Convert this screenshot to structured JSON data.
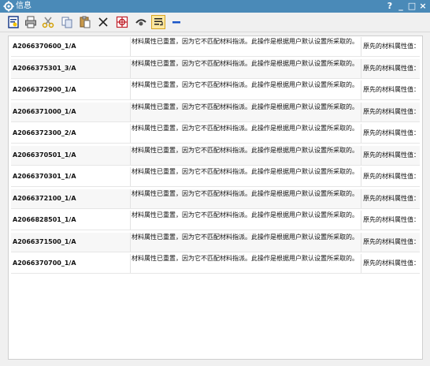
{
  "window": {
    "title": "信息",
    "help": "?",
    "minimize": "_",
    "maximize": "□",
    "close": "×"
  },
  "toolbar": {
    "buttons": [
      {
        "name": "save-info-icon"
      },
      {
        "name": "print-icon"
      },
      {
        "name": "cut-icon"
      },
      {
        "name": "copy-icon"
      },
      {
        "name": "paste-icon"
      },
      {
        "name": "delete-icon"
      },
      {
        "name": "find-icon"
      },
      {
        "name": "highlight-icon"
      },
      {
        "name": "wrap-text-icon"
      },
      {
        "name": "collapse-icon"
      }
    ]
  },
  "rows": [
    {
      "part": "A2066370600_1/A",
      "message": "材料属性已重置，因为它不匹配材料指派。此操作是根据用户默认设置所采取的。",
      "note": "原先的材料属性值："
    },
    {
      "part": "A2066375301_3/A",
      "message": "材料属性已重置，因为它不匹配材料指派。此操作是根据用户默认设置所采取的。",
      "note": "原先的材料属性值："
    },
    {
      "part": "A2066372900_1/A",
      "message": "材料属性已重置，因为它不匹配材料指派。此操作是根据用户默认设置所采取的。",
      "note": "原先的材料属性值："
    },
    {
      "part": "A2066371000_1/A",
      "message": "材料属性已重置，因为它不匹配材料指派。此操作是根据用户默认设置所采取的。",
      "note": "原先的材料属性值："
    },
    {
      "part": "A2066372300_2/A",
      "message": "材料属性已重置，因为它不匹配材料指派。此操作是根据用户默认设置所采取的。",
      "note": "原先的材料属性值："
    },
    {
      "part": "A2066370501_1/A",
      "message": "材料属性已重置，因为它不匹配材料指派。此操作是根据用户默认设置所采取的。",
      "note": "原先的材料属性值："
    },
    {
      "part": "A2066370301_1/A",
      "message": "材料属性已重置，因为它不匹配材料指派。此操作是根据用户默认设置所采取的。",
      "note": "原先的材料属性值："
    },
    {
      "part": "A2066372100_1/A",
      "message": "材料属性已重置，因为它不匹配材料指派。此操作是根据用户默认设置所采取的。",
      "note": "原先的材料属性值："
    },
    {
      "part": "A2066828501_1/A",
      "message": "材料属性已重置，因为它不匹配材料指派。此操作是根据用户默认设置所采取的。",
      "note": "原先的材料属性值："
    },
    {
      "part": "A2066371500_1/A",
      "message": "材料属性已重置，因为它不匹配材料指派。此操作是根据用户默认设置所采取的。",
      "note": "原先的材料属性值："
    },
    {
      "part": "A2066370700_1/A",
      "message": "材料属性已重置，因为它不匹配材料指派。此操作是根据用户默认设置所采取的。",
      "note": "原先的材料属性值："
    }
  ]
}
